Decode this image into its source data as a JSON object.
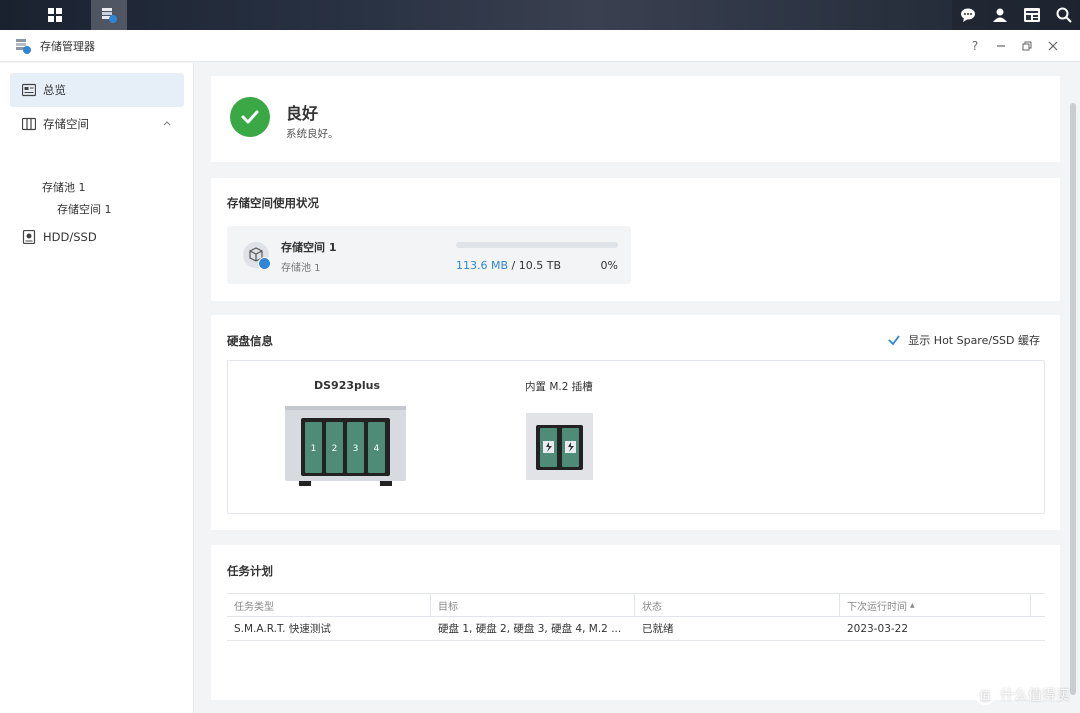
{
  "window": {
    "title": "存储管理器"
  },
  "sidebar": {
    "items": [
      {
        "label": "总览",
        "selected": true
      },
      {
        "label": "存储空间",
        "expanded": true
      },
      {
        "label": "HDD/SSD"
      }
    ],
    "pool_label": "存储池 1",
    "volume_label": "存储空间 1"
  },
  "status": {
    "title": "良好",
    "subtitle": "系统良好。",
    "color": "#39a845"
  },
  "usage": {
    "heading": "存储空间使用状况",
    "volume_name": "存储空间 1",
    "pool": "存储池 1",
    "used": "113.6 MB",
    "separator": " / ",
    "total": "10.5 TB",
    "percent_text": "0%",
    "percent_value": 0
  },
  "disk_info": {
    "heading": "硬盘信息",
    "hotspare_label": "显示 Hot Spare/SSD 缓存",
    "hotspare_checked": true,
    "device_name": "DS923plus",
    "bays": [
      "1",
      "2",
      "3",
      "4"
    ],
    "m2_label": "内置 M.2 插槽"
  },
  "schedule": {
    "heading": "任务计划",
    "columns": [
      "任务类型",
      "目标",
      "状态",
      "下次运行时间"
    ],
    "sort_indicator": "▲",
    "rows": [
      [
        "S.M.A.R.T. 快速测试",
        "硬盘 1, 硬盘 2, 硬盘 3, 硬盘 4, M.2 ...",
        "已就绪",
        "2023-03-22"
      ]
    ]
  },
  "watermark": {
    "icon_text": "值",
    "text": "什么值得买"
  },
  "accent_color": "#2f86d8"
}
